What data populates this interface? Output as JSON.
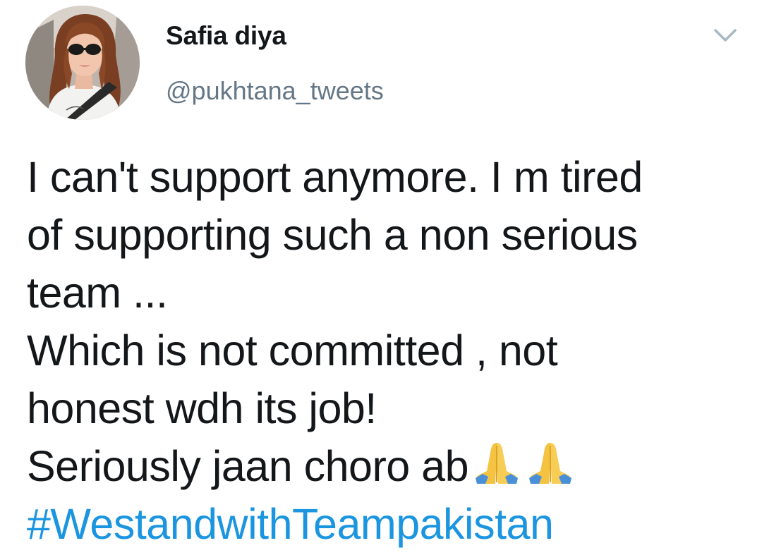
{
  "tweet": {
    "author": {
      "display_name": "Safia diya",
      "handle": "@pukhtana_tweets",
      "avatar_icon": "profile-photo-woman-sunglasses"
    },
    "menu_icon": "chevron-down-icon",
    "body_lines": [
      "I can't support anymore. I m tired",
      "of supporting such a non serious",
      "team ...",
      "Which is not committed , not",
      "honest wdh its job!",
      "Seriously jaan choro ab"
    ],
    "emojis": [
      "folded-hands-icon",
      "folded-hands-icon"
    ],
    "hashtag": "#WestandwithTeampakistan"
  },
  "colors": {
    "text": "#14171a",
    "secondary": "#657786",
    "link": "#1b95e0",
    "background": "#ffffff"
  }
}
